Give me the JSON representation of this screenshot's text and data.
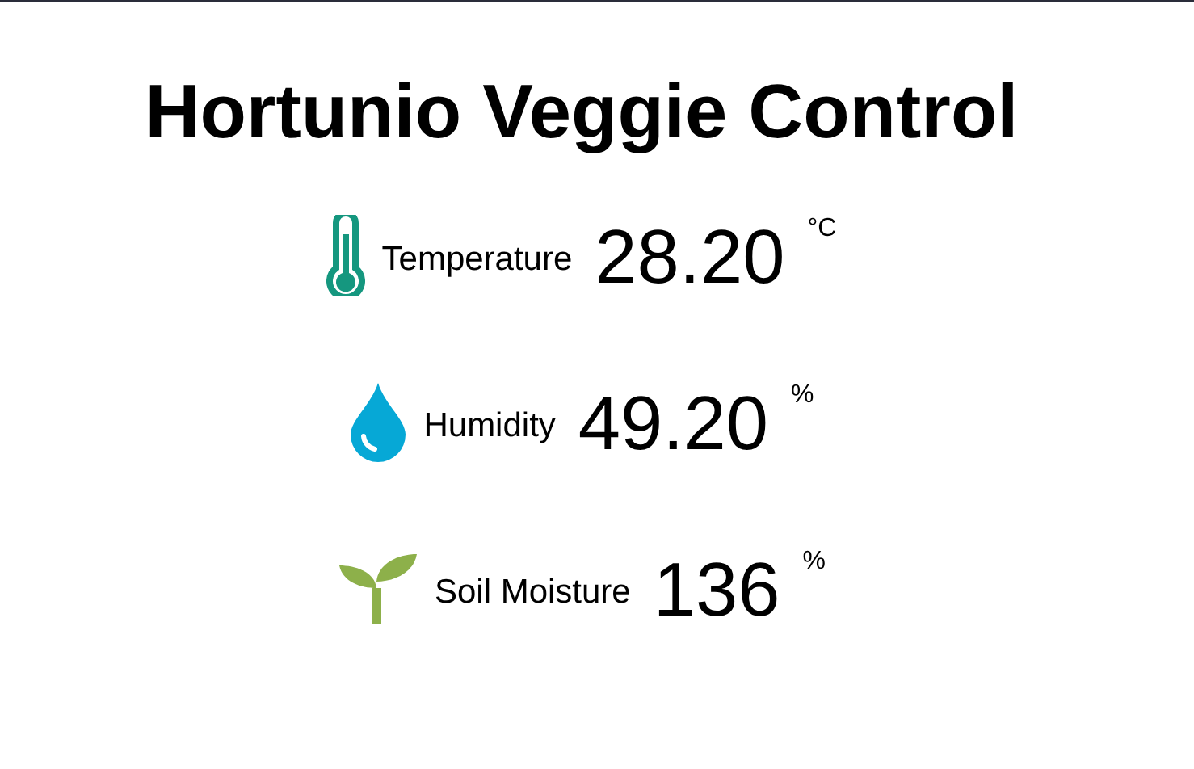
{
  "title": "Hortunio Veggie Control",
  "readings": [
    {
      "kind": "temperature",
      "label": "Temperature",
      "value": "28.20",
      "unit": "°C"
    },
    {
      "kind": "humidity",
      "label": "Humidity",
      "value": "49.20",
      "unit": "%"
    },
    {
      "kind": "soil",
      "label": "Soil Moisture",
      "value": "136",
      "unit": "%"
    }
  ]
}
